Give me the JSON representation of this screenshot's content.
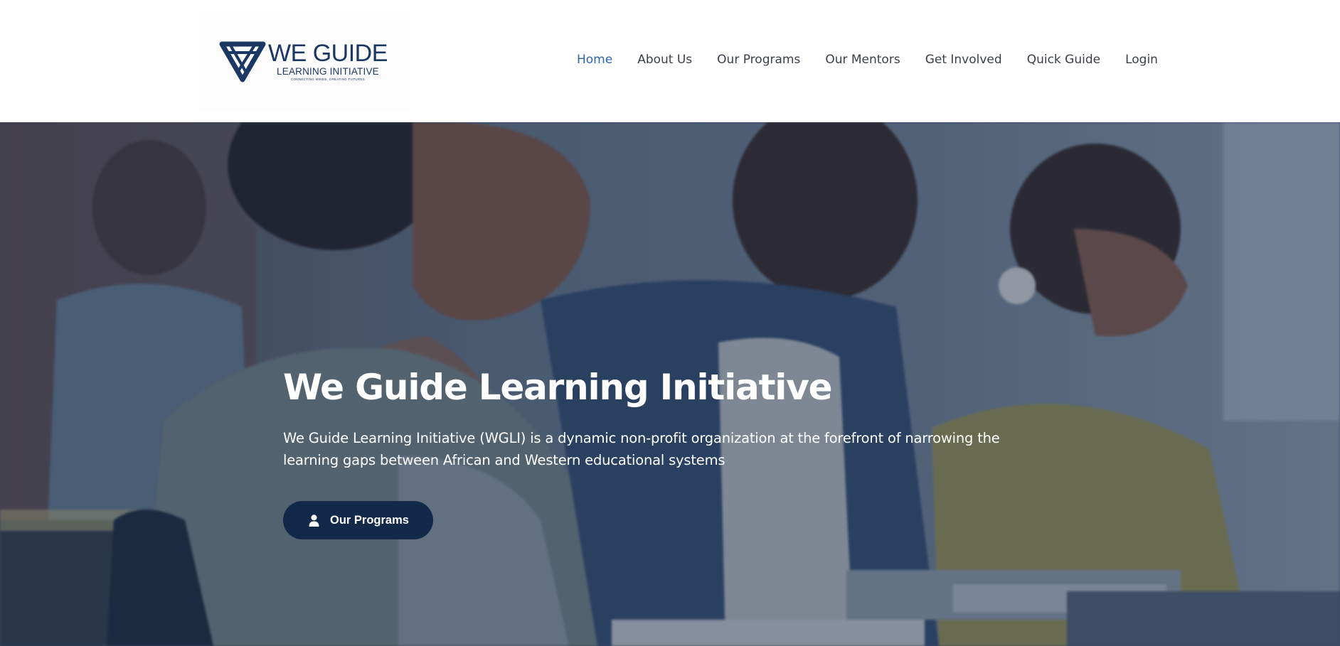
{
  "brand": {
    "title": "WE GUIDE",
    "subtitle": "LEARNING INITIATIVE",
    "tagline": "CONNECTING MINDS, CREATING FUTURES",
    "logo_icon": "triangle-knot-icon",
    "color": "#1b3764"
  },
  "nav": {
    "items": [
      {
        "label": "Home",
        "active": true
      },
      {
        "label": "About Us",
        "active": false
      },
      {
        "label": "Our Programs",
        "active": false
      },
      {
        "label": "Our Mentors",
        "active": false
      },
      {
        "label": "Get Involved",
        "active": false
      },
      {
        "label": "Quick Guide",
        "active": false
      },
      {
        "label": "Login",
        "active": false
      }
    ],
    "active_color": "#2e67a7",
    "text_color": "#3c3f4a"
  },
  "hero": {
    "title": "We Guide Learning Initiative",
    "description": "We Guide Learning Initiative (WGLI) is a dynamic non-profit organization at the forefront of narrowing the learning gaps between African and Western educational systems",
    "button": {
      "label": "Our Programs",
      "icon": "user-icon",
      "color": "#13294a"
    },
    "background_image": "smiling-students-in-classroom-photo"
  }
}
